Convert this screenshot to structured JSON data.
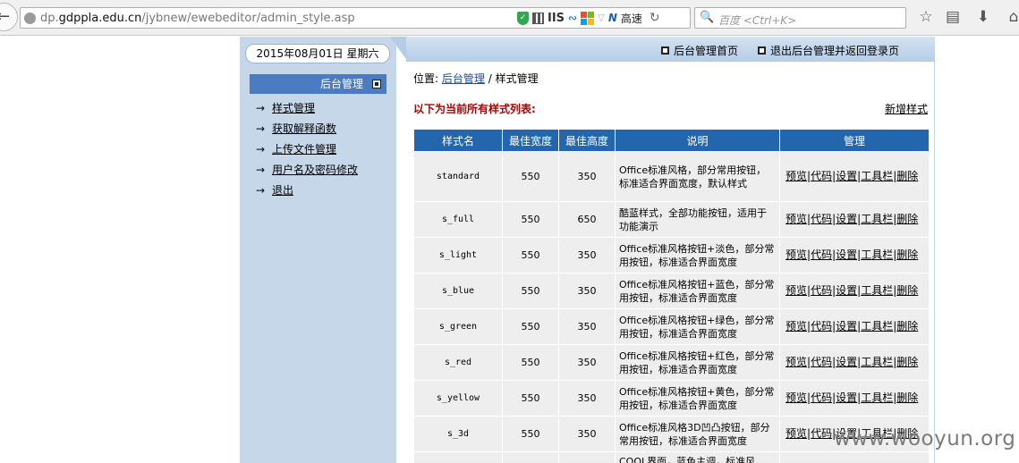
{
  "browser": {
    "url_prefix": "dp.",
    "url_domain": "gdppla.edu.cn",
    "url_path": "/jybnew/ewebeditor/admin_style.asp",
    "iis_label": "IIS",
    "speed_label": "高速",
    "search_placeholder": "百度 <Ctrl+K>"
  },
  "header": {
    "date": "2015年08月01日  星期六",
    "nav": [
      "后台管理首页",
      "退出后台管理并返回登录页"
    ]
  },
  "sidebar": {
    "title": "后台管理",
    "items": [
      {
        "label": "样式管理"
      },
      {
        "label": "获取解释函数"
      },
      {
        "label": "上传文件管理"
      },
      {
        "label": "用户名及密码修改"
      },
      {
        "label": "退出"
      }
    ]
  },
  "main": {
    "crumb_prefix": "位置:",
    "crumb_link": "后台管理",
    "crumb_sep": "/",
    "crumb_current": "样式管理",
    "list_title": "以下为当前所有样式列表:",
    "add_link": "新增样式",
    "columns": [
      "样式名",
      "最佳宽度",
      "最佳高度",
      "说明",
      "管理"
    ],
    "actions": [
      "预览",
      "代码",
      "设置",
      "工具栏",
      "删除"
    ],
    "rows": [
      {
        "name": "standard",
        "width": "550",
        "height": "350",
        "desc": "Office标准风格，部分常用按钮，标准适合界面宽度，默认样式"
      },
      {
        "name": "s_full",
        "width": "550",
        "height": "650",
        "desc": "酷蓝样式，全部功能按钮，适用于功能演示"
      },
      {
        "name": "s_light",
        "width": "550",
        "height": "350",
        "desc": "Office标准风格按钮+淡色，部分常用按钮，标准适合界面宽度"
      },
      {
        "name": "s_blue",
        "width": "550",
        "height": "350",
        "desc": "Office标准风格按钮+蓝色，部分常用按钮，标准适合界面宽度"
      },
      {
        "name": "s_green",
        "width": "550",
        "height": "350",
        "desc": "Office标准风格按钮+绿色，部分常用按钮，标准适合界面宽度"
      },
      {
        "name": "s_red",
        "width": "550",
        "height": "350",
        "desc": "Office标准风格按钮+红色，部分常用按钮，标准适合界面宽度"
      },
      {
        "name": "s_yellow",
        "width": "550",
        "height": "350",
        "desc": "Office标准风格按钮+黄色，部分常用按钮，标准适合界面宽度"
      },
      {
        "name": "s_3d",
        "width": "550",
        "height": "350",
        "desc": "Office标准风格3D凹凸按钮，部分常用按钮，标准适合界面宽度"
      },
      {
        "name": "",
        "width": "",
        "height": "",
        "desc": "COOL界面，蓝色主调，标准风"
      }
    ]
  },
  "watermark": "www.wooyun.org"
}
